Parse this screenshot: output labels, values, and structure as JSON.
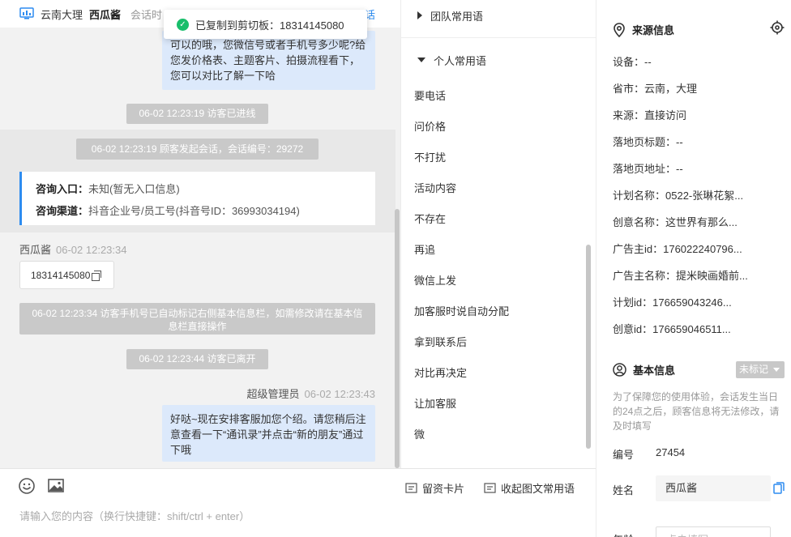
{
  "header": {
    "location": "云南大理",
    "visitor_name": "西瓜酱",
    "meta_partial": "会话时",
    "link_partial": "话"
  },
  "toast": {
    "text": "已复制到剪切板：18314145080"
  },
  "chat": {
    "agent_message_1": "可以的哦，您微信号或者手机号多少呢?给您发价格表、主题客片、拍摄流程看下，您可以对比了解一下哈",
    "sys_visitor_entered": "06-02 12:23:19 访客已进线",
    "sys_session_started": "06-02 12:23:19 顾客发起会话，会话编号：29272",
    "entry_card": {
      "entry_label": "咨询入口：",
      "entry_value": "未知(暂无入口信息)",
      "channel_label": "咨询渠道：",
      "channel_value": "抖音企业号/员工号(抖音号ID：36993034194)"
    },
    "visitor_name": "西瓜酱",
    "visitor_time": "06-02 12:23:34",
    "visitor_phone": "18314145080",
    "sys_phone_marked": "06-02 12:23:34 访客手机号已自动标记右侧基本信息栏，如需修改请在基本信息栏直接操作",
    "sys_visitor_left": "06-02 12:23:44 访客已离开",
    "agent_name": "超级管理员",
    "agent_time": "06-02 12:23:43",
    "agent_message_2": "好哒~现在安排客服加您个绍。请您稍后注意查看一下“通讯录”并点击“新的朋友”通过下哦"
  },
  "composer": {
    "lead_card": "留资卡片",
    "collapse_phrases": "收起图文常用语",
    "placeholder": "请输入您的内容（换行快捷键：shift/ctrl + enter）"
  },
  "phrases": {
    "team_group": "团队常用语",
    "personal_group": "个人常用语",
    "items": [
      "要电话",
      "问价格",
      "不打扰",
      "活动内容",
      "不存在",
      "再追",
      "微信上发",
      "加客服时说自动分配",
      "拿到联系后",
      "对比再决定",
      "让加客服",
      "微"
    ]
  },
  "source": {
    "title": "来源信息",
    "device": "设备：--",
    "region": "省市：云南，大理",
    "origin": "来源：直接访问",
    "landing_title": "落地页标题：--",
    "landing_url": "落地页地址：--",
    "plan_name": "计划名称：0522-张琳花絮...",
    "creative_name": "创意名称：这世界有那么...",
    "advertiser_id": "广告主id：176022240796...",
    "advertiser_name": "广告主名称：提米映画婚前...",
    "plan_id": "计划id：176659043246...",
    "creative_id": "创意id：176659046511..."
  },
  "basic": {
    "title": "基本信息",
    "badge": "未标记",
    "note": "为了保障您的使用体验，会话发生当日的24点之后，顾客信息将无法修改，请及时填写",
    "number_label": "编号",
    "number_value": "27454",
    "name_label": "姓名",
    "name_value": "西瓜酱",
    "age_label": "年龄",
    "age_placeholder": "点击填写"
  },
  "colors": {
    "accent": "#2d8cf0",
    "success": "#19be6b",
    "bubble": "#dce9fb",
    "system_pill": "#c9c9c9"
  }
}
